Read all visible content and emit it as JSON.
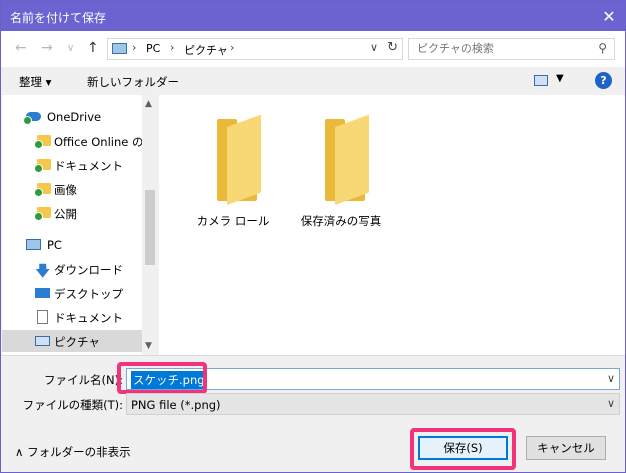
{
  "window": {
    "title": "名前を付けて保存",
    "close_glyph": "✕"
  },
  "nav": {
    "back_glyph": "←",
    "forward_glyph": "→",
    "recent_glyph": "∨",
    "up_glyph": "↑",
    "breadcrumb": [
      "PC",
      "ピクチャ"
    ],
    "sep_glyph": "›",
    "refresh_glyph": "↻",
    "search_placeholder": "ピクチャの検索"
  },
  "toolbar": {
    "organize_label": "整理 ▾",
    "new_folder_label": "新しいフォルダー",
    "help_label": "?"
  },
  "sidebar": {
    "items": [
      {
        "label": "OneDrive"
      },
      {
        "label": "Office Online の"
      },
      {
        "label": "ドキュメント"
      },
      {
        "label": "画像"
      },
      {
        "label": "公開"
      },
      {
        "label": "PC"
      },
      {
        "label": "ダウンロード"
      },
      {
        "label": "デスクトップ"
      },
      {
        "label": "ドキュメント"
      },
      {
        "label": "ピクチャ"
      }
    ]
  },
  "folders": [
    {
      "label": "カメラ ロール"
    },
    {
      "label": "保存済みの写真"
    }
  ],
  "form": {
    "filename_label": "ファイル名(N):",
    "filename_value": "スケッチ.png",
    "filetype_label": "ファイルの種類(T):",
    "filetype_value": "PNG file (*.png)"
  },
  "footer": {
    "hide_folders_label": "∧ フォルダーの非表示",
    "save_label": "保存(S)",
    "cancel_label": "キャンセル"
  },
  "colors": {
    "titlebar": "#6b63d0",
    "highlight": "#f0337b",
    "selection": "#0078d7"
  }
}
